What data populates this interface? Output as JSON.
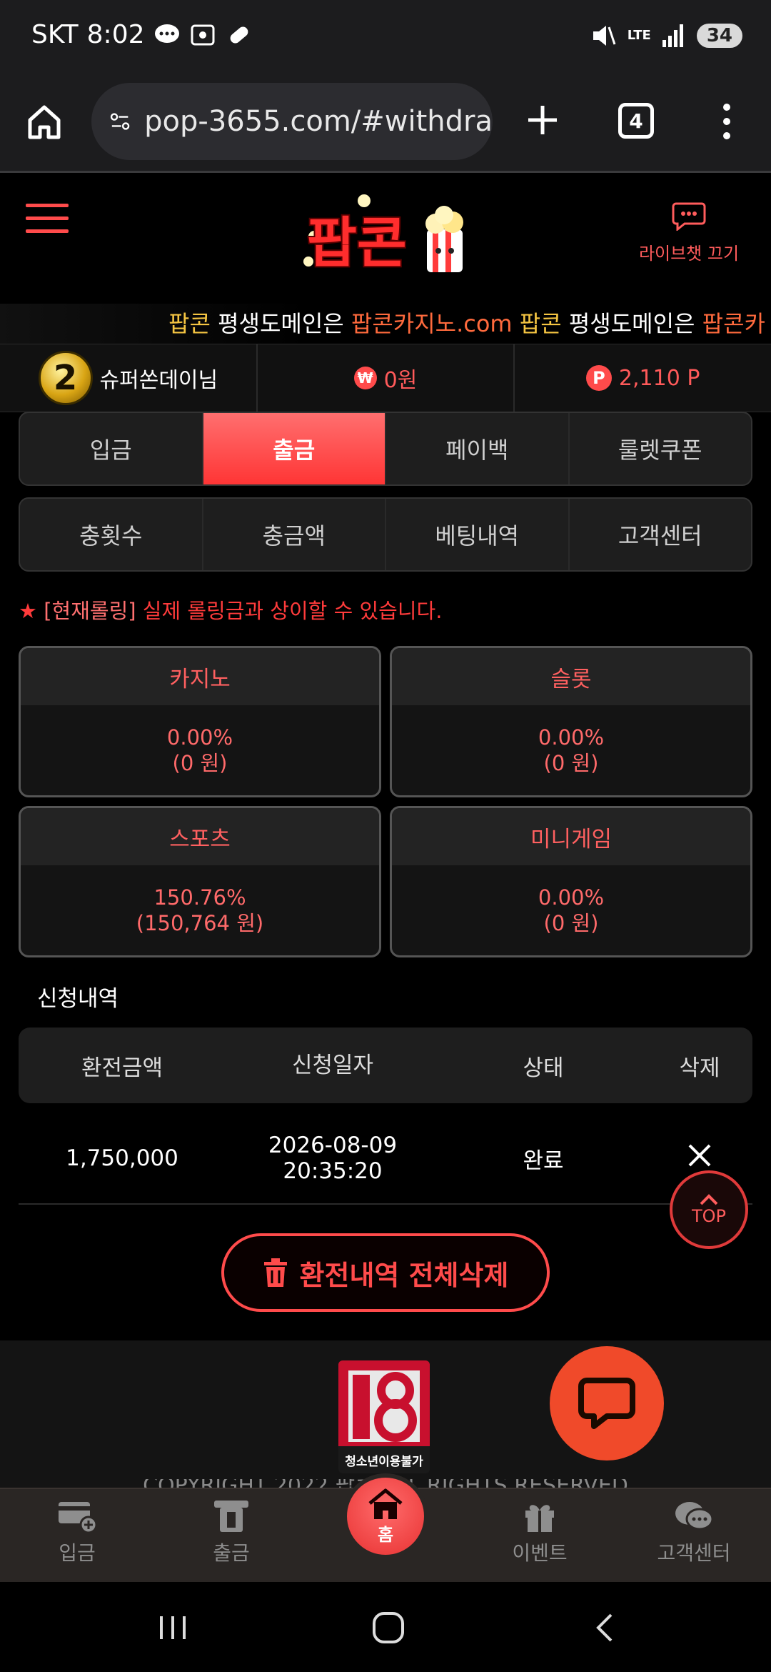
{
  "status_bar": {
    "carrier": "SKT",
    "time": "8:02",
    "network": "LTE",
    "battery": "34"
  },
  "browser": {
    "url": "pop-3655.com/#withdra",
    "tab_count": "4"
  },
  "header": {
    "livechat_label": "라이브챗 끄기",
    "logo_text": "팝콘"
  },
  "marquee": [
    {
      "text": "팝콘",
      "style": "brand"
    },
    {
      "text": " 평생도메인은 ",
      "style": "plain"
    },
    {
      "text": "팝콘카지노.com",
      "style": "domain"
    },
    {
      "text": " 팝콘",
      "style": "brand"
    },
    {
      "text": " 평생도메인은 ",
      "style": "plain"
    },
    {
      "text": "팝콘카",
      "style": "domain"
    }
  ],
  "user": {
    "level": "2",
    "nickname": "슈퍼쏜데이님",
    "money": "0원",
    "points": "2,110 P",
    "currency_icon": "₩",
    "point_icon": "P"
  },
  "tabs_row1": [
    {
      "label": "입금",
      "active": false
    },
    {
      "label": "출금",
      "active": true
    },
    {
      "label": "페이백",
      "active": false
    },
    {
      "label": "룰렛쿠폰",
      "active": false
    }
  ],
  "tabs_row2": [
    {
      "label": "충횟수"
    },
    {
      "label": "충금액"
    },
    {
      "label": "베팅내역"
    },
    {
      "label": "고객센터"
    }
  ],
  "notice": {
    "star": "★",
    "bracket": "[현재롤링]",
    "text": "실제 롤링금과 상이할 수 있습니다."
  },
  "rolling": [
    {
      "name": "카지노",
      "percent": "0.00%",
      "amount": "(0 원)"
    },
    {
      "name": "슬롯",
      "percent": "0.00%",
      "amount": "(0 원)"
    },
    {
      "name": "스포츠",
      "percent": "150.76%",
      "amount": "(150,764 원)"
    },
    {
      "name": "미니게임",
      "percent": "0.00%",
      "amount": "(0 원)"
    }
  ],
  "history": {
    "title": "신청내역",
    "columns": [
      "환전금액",
      "신청일자",
      "상태",
      "삭제"
    ],
    "rows": [
      {
        "amount": "1,750,000",
        "date": "2026-08-09",
        "time": "20:35:20",
        "status": "완료"
      }
    ]
  },
  "top_button": "TOP",
  "delete_all_label": "환전내역 전체삭제",
  "footer": {
    "age_label": "청소년이용불가",
    "copyright": "COPYRIGHT 2022 팝콘 ALL RIGHTS RESERVED"
  },
  "bottom_nav": {
    "deposit": "입금",
    "withdraw": "출금",
    "home": "홈",
    "event": "이벤트",
    "support": "고객센터"
  },
  "colors": {
    "accent": "#ff4b4b",
    "background": "#000000",
    "brand_yellow": "#f5c542"
  }
}
